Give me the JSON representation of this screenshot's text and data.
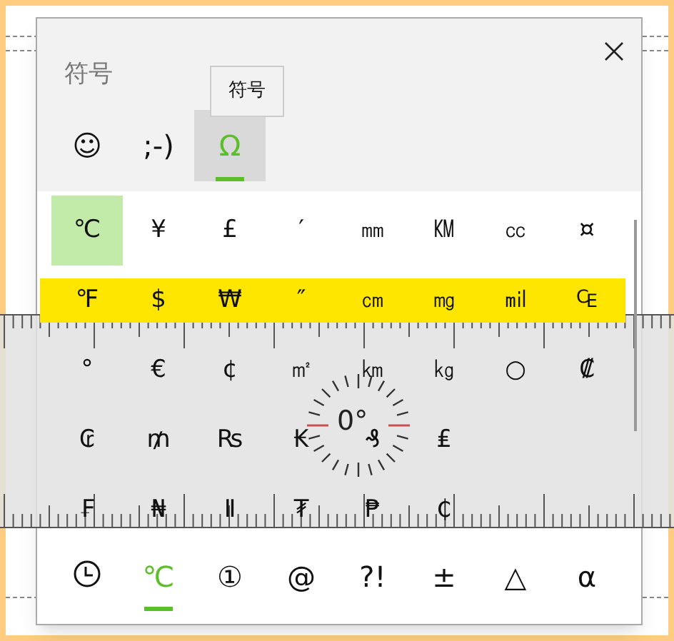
{
  "panel": {
    "title": "符号",
    "tooltip": "符号"
  },
  "tabs": [
    {
      "label": "☺",
      "selected": false
    },
    {
      "label": ";-)",
      "selected": false
    },
    {
      "label": "Ω",
      "selected": true
    }
  ],
  "symbol_rows": [
    {
      "highlighted": false,
      "symbols": [
        {
          "label": "℃",
          "selected": true
        },
        {
          "label": "¥",
          "selected": false
        },
        {
          "label": "£",
          "selected": false
        },
        {
          "label": "′",
          "selected": false
        },
        {
          "label": "㎜",
          "selected": false
        },
        {
          "label": "㏎",
          "selected": false
        },
        {
          "label": "㏄",
          "selected": false
        },
        {
          "label": "¤",
          "selected": false
        }
      ]
    },
    {
      "highlighted": true,
      "symbols": [
        {
          "label": "℉",
          "selected": false
        },
        {
          "label": "$",
          "selected": false
        },
        {
          "label": "₩",
          "selected": false
        },
        {
          "label": "″",
          "selected": false
        },
        {
          "label": "㎝",
          "selected": false
        },
        {
          "label": "㎎",
          "selected": false
        },
        {
          "label": "㏕",
          "selected": false
        },
        {
          "label": "₠",
          "selected": false
        }
      ]
    },
    {
      "highlighted": false,
      "symbols": [
        {
          "label": "°",
          "selected": false
        },
        {
          "label": "€",
          "selected": false
        },
        {
          "label": "¢",
          "selected": false
        },
        {
          "label": "㎡",
          "selected": false
        },
        {
          "label": "㎞",
          "selected": false
        },
        {
          "label": "㎏",
          "selected": false
        },
        {
          "label": "○",
          "selected": false
        },
        {
          "label": "₡",
          "selected": false
        }
      ]
    },
    {
      "highlighted": false,
      "symbols": [
        {
          "label": "₢",
          "selected": false
        },
        {
          "label": "₥",
          "selected": false
        },
        {
          "label": "₨",
          "selected": false
        },
        {
          "label": "₭",
          "selected": false
        },
        {
          "label": "₰",
          "selected": false
        },
        {
          "label": "₤",
          "selected": false
        }
      ]
    },
    {
      "highlighted": false,
      "symbols": [
        {
          "label": "₣",
          "selected": false
        },
        {
          "label": "₦",
          "selected": false
        },
        {
          "label": "Ⅱ",
          "selected": false
        },
        {
          "label": "₮",
          "selected": false
        },
        {
          "label": "₱",
          "selected": false
        },
        {
          "label": "₵",
          "selected": false
        }
      ]
    }
  ],
  "ruler": {
    "dial_reading": "0°"
  },
  "categories": [
    {
      "kind": "clock",
      "selected": false
    },
    {
      "kind": "text",
      "label": "℃",
      "selected": true
    },
    {
      "kind": "text",
      "label": "①",
      "selected": false
    },
    {
      "kind": "text",
      "label": "@",
      "selected": false
    },
    {
      "kind": "text",
      "label": "?!",
      "selected": false
    },
    {
      "kind": "text",
      "label": "±",
      "selected": false
    },
    {
      "kind": "text",
      "label": "△",
      "selected": false
    },
    {
      "kind": "text",
      "label": "α",
      "selected": false
    }
  ]
}
